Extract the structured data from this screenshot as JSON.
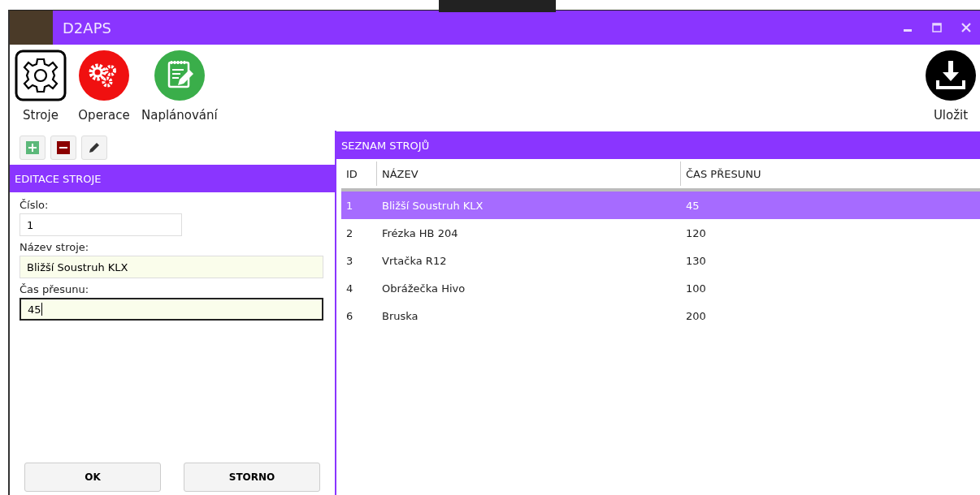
{
  "window": {
    "title": "D2APS"
  },
  "toolbar": {
    "items": [
      {
        "label": "Stroje",
        "kind": "gear",
        "selected": true
      },
      {
        "label": "Operace",
        "kind": "gears",
        "selected": false
      },
      {
        "label": "Naplánování",
        "kind": "notepad",
        "selected": false
      }
    ],
    "save": {
      "label": "Uložit"
    }
  },
  "editor": {
    "title": "EDITACE STROJE",
    "fields": [
      {
        "label": "Číslo:",
        "value": "1",
        "tinted": false,
        "focused": false,
        "wide": false
      },
      {
        "label": "Název stroje:",
        "value": "Bližší Soustruh KLX",
        "tinted": true,
        "focused": false,
        "wide": true
      },
      {
        "label": "Čas přesunu:",
        "value": "45",
        "tinted": true,
        "focused": true,
        "wide": true
      }
    ],
    "buttons": [
      "OK",
      "STORNO"
    ]
  },
  "table": {
    "title": "SEZNAM STROJŮ",
    "columns": [
      "ID",
      "NÁZEV",
      "ČAS PŘESUNU"
    ],
    "rows": [
      {
        "cells": [
          "1",
          "Bližší Soustruh KLX",
          "45"
        ],
        "selected": true
      },
      {
        "cells": [
          "2",
          "Frézka HB 204",
          "120"
        ],
        "selected": false
      },
      {
        "cells": [
          "3",
          "Vrtačka R12",
          "130"
        ],
        "selected": false
      },
      {
        "cells": [
          "4",
          "Obrážečka Hivo",
          "100"
        ],
        "selected": false
      },
      {
        "cells": [
          "6",
          "Bruska",
          "200"
        ],
        "selected": false
      }
    ]
  }
}
